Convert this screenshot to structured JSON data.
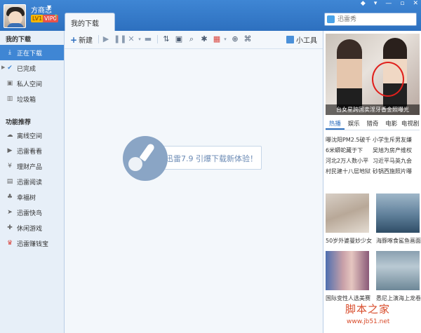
{
  "user": {
    "name": "方商志",
    "level_badge": "LV1",
    "vip_badge": "VIP0"
  },
  "tabs": {
    "main": "我的下载"
  },
  "search": {
    "placeholder": "迅雷秀"
  },
  "toolbar": {
    "new_label": "新建",
    "tools_label": "小工具"
  },
  "sidebar": {
    "section1_title": "我的下载",
    "downloads": [
      {
        "label": "正在下载",
        "icon": "download-icon"
      },
      {
        "label": "已完成",
        "icon": "check-icon"
      },
      {
        "label": "私人空间",
        "icon": "lock-icon"
      },
      {
        "label": "垃圾箱",
        "icon": "trash-icon"
      }
    ],
    "section2_title": "功能推荐",
    "features": [
      {
        "label": "离线空间",
        "icon": "cloud-icon"
      },
      {
        "label": "迅雷看看",
        "icon": "play-icon"
      },
      {
        "label": "理财产品",
        "icon": "money-icon"
      },
      {
        "label": "迅雷阅读",
        "icon": "book-icon"
      },
      {
        "label": "幸福树",
        "icon": "tree-icon"
      },
      {
        "label": "迅雷快鸟",
        "icon": "bird-icon"
      },
      {
        "label": "休闲游戏",
        "icon": "gamepad-icon"
      },
      {
        "label": "迅雷赚钱宝",
        "icon": "treasure-icon"
      }
    ]
  },
  "main": {
    "slogan": "迅雷7.9 引爆下载新体验！"
  },
  "right_panel": {
    "hero_caption": "台女星跨国卖淫牙香金照曝光",
    "tabs": [
      "热播",
      "娱乐",
      "猎奇",
      "电影",
      "电视剧"
    ],
    "news": [
      [
        "曝沈阳PM2.5破千",
        "小学生斥男友嫌"
      ],
      [
        "6米蟒蛇藏于下",
        "吴旭为房产维权"
      ],
      [
        "河北2万人数小平",
        "习近平马英九会"
      ],
      [
        "村民建十八层地狱",
        "砂锅西施照片曝"
      ]
    ],
    "thumbs": [
      "50岁外婆曼妙少女",
      "海豚啄食鲨鱼画面",
      "国际变性人选美赛",
      "悉尼上演海上龙卷"
    ]
  },
  "watermark": {
    "title": "脚本之家",
    "url": "www.jb51.net"
  },
  "colors": {
    "accent": "#3f86d4",
    "brand_red": "#d84b2a"
  }
}
